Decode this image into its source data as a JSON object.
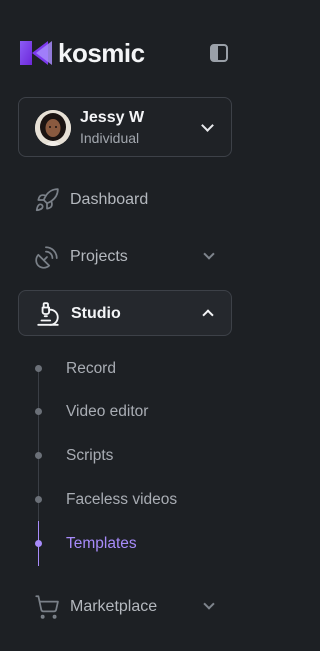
{
  "brand": {
    "name": "kosmic",
    "accent": "#a78bfa"
  },
  "user": {
    "name": "Jessy W",
    "plan": "Individual"
  },
  "nav": {
    "dashboard": {
      "label": "Dashboard",
      "icon": "rocket-icon"
    },
    "projects": {
      "label": "Projects",
      "icon": "satellite-dish-icon"
    },
    "studio": {
      "label": "Studio",
      "icon": "microscope-icon",
      "items": [
        {
          "label": "Record"
        },
        {
          "label": "Video editor"
        },
        {
          "label": "Scripts"
        },
        {
          "label": "Faceless videos"
        },
        {
          "label": "Templates",
          "active": true
        }
      ]
    },
    "marketplace": {
      "label": "Marketplace",
      "icon": "shopping-cart-icon"
    }
  }
}
